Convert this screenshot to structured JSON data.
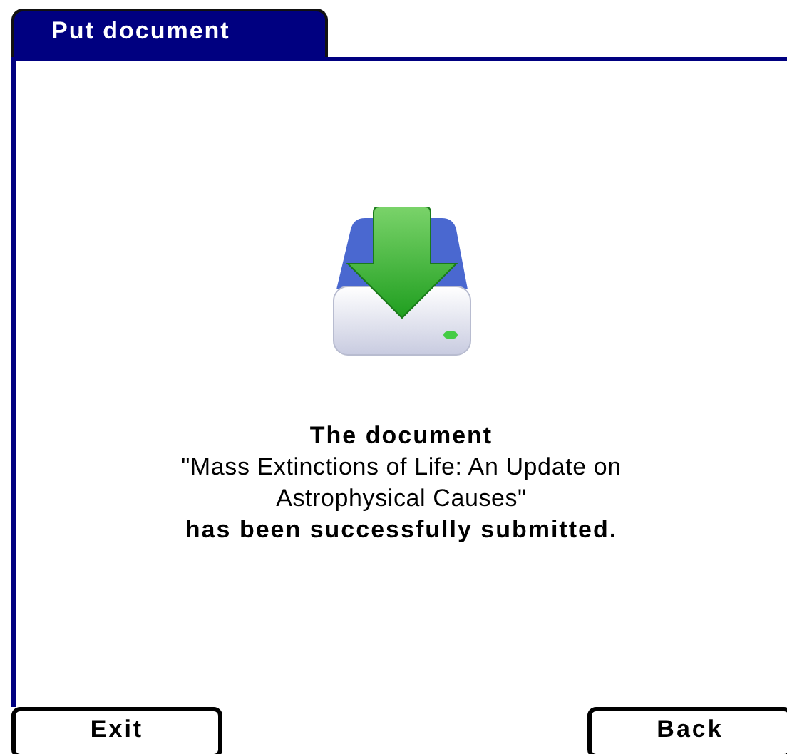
{
  "tab": {
    "label": "Put document",
    "selected": true
  },
  "message": {
    "heading": "The document",
    "document_title": "\"Mass Extinctions of Life: An Update on Astrophysical Causes\"",
    "status": "has been successfully submitted."
  },
  "buttons": [
    {
      "label": "Exit",
      "kind": "left"
    },
    {
      "label": "Back",
      "kind": "right"
    }
  ]
}
